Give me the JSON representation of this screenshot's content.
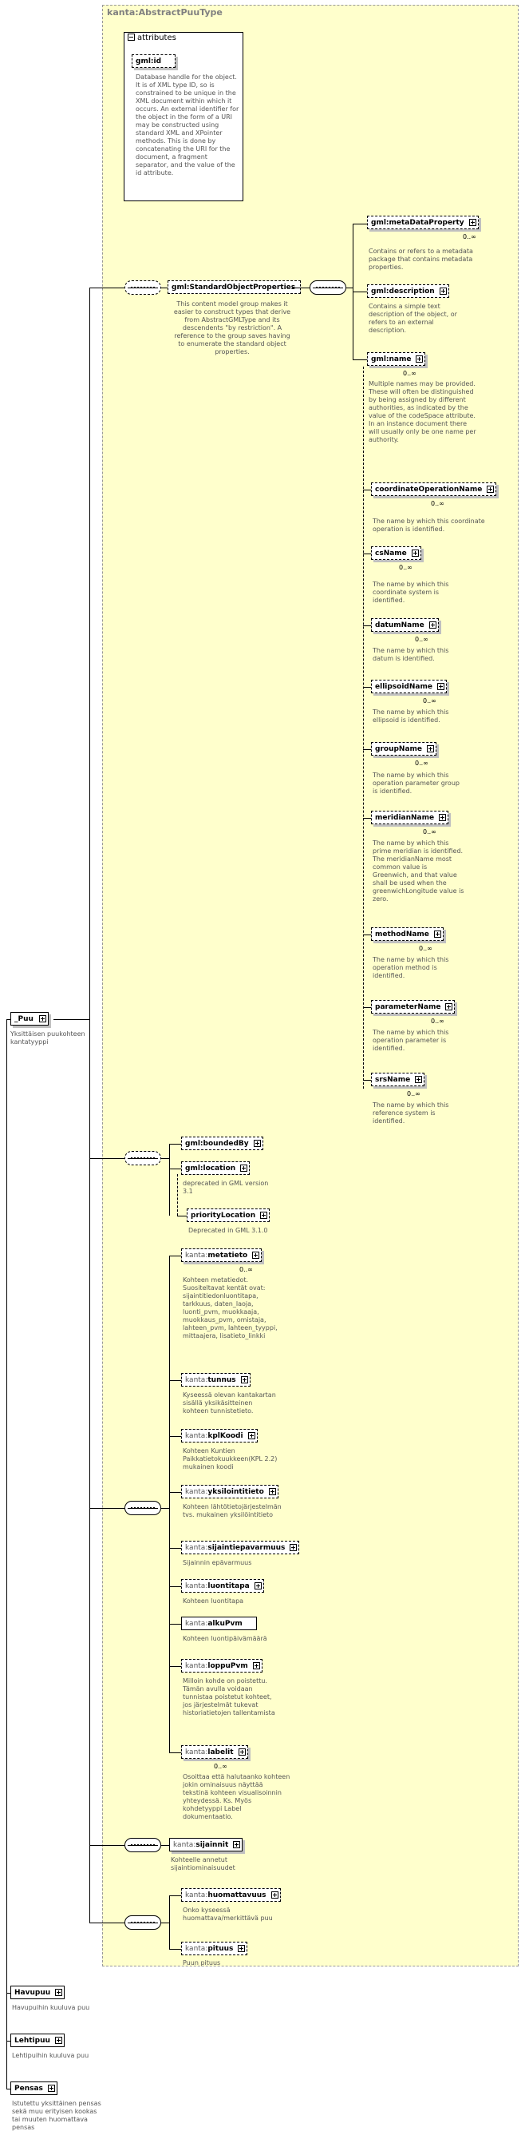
{
  "type_title": "kanta:AbstractPuuType",
  "attributes": {
    "header": "attributes",
    "gmlid": {
      "label": "gml:id",
      "desc": "Database handle for the object.  It is of XML type ID, so is constrained to be unique in the XML document within which it occurs.  An external identifier for the object in the form of a URI may be constructed using standard XML and XPointer methods.  This is done by concatenating the URI for the document, a fragment separator, and the value of the id attribute."
    }
  },
  "root": {
    "label": "_Puu",
    "desc": "Yksittäisen puukohteen kantatyyppi"
  },
  "standard_object_properties": {
    "label": "gml:StandardObjectProperties",
    "desc": "This content model group makes it easier to construct types that derive from AbstractGMLType and its descendents \"by restriction\".  A reference to the group saves having to enumerate the standard object properties."
  },
  "gml_elements": [
    {
      "label": "gml:metaDataProperty",
      "desc": "Contains or refers to a metadata package that contains metadata properties.",
      "mult": "0..∞"
    },
    {
      "label": "gml:description",
      "desc": "Contains a simple text description of the object, or refers to an external description.",
      "mult": ""
    },
    {
      "label": "gml:name",
      "desc": "Multiple names may be provided.  These will often be distinguished by being assigned by different authorities, as indicated by the value of the codeSpace attribute.  In an instance document there will usually only be one name per authority.",
      "mult": "0..∞"
    }
  ],
  "name_substitutions": [
    {
      "label": "coordinateOperationName",
      "desc": "The name by which this coordinate operation is identified.",
      "mult": "0..∞"
    },
    {
      "label": "csName",
      "desc": "The name by which this coordinate system is identified.",
      "mult": "0..∞"
    },
    {
      "label": "datumName",
      "desc": "The name by which this datum is identified.",
      "mult": "0..∞"
    },
    {
      "label": "ellipsoidName",
      "desc": "The name by which this ellipsoid is identified.",
      "mult": "0..∞"
    },
    {
      "label": "groupName",
      "desc": "The name by which this operation parameter group is identified.",
      "mult": "0..∞"
    },
    {
      "label": "meridianName",
      "desc": "The name by which this prime meridian is identified. The meridianName most common value is Greenwich, and that value shall be used when the greenwichLongitude value is zero.",
      "mult": "0..∞"
    },
    {
      "label": "methodName",
      "desc": "The name by which this operation method is identified.",
      "mult": "0..∞"
    },
    {
      "label": "parameterName",
      "desc": "The name by which this operation parameter is identified.",
      "mult": "0..∞"
    },
    {
      "label": "srsName",
      "desc": "The name by which this reference system is identified.",
      "mult": "0..∞"
    }
  ],
  "bounded_group": [
    {
      "label": "gml:boundedBy",
      "desc": ""
    },
    {
      "label": "gml:location",
      "desc": "deprecated in GML version 3.1"
    },
    {
      "label": "priorityLocation",
      "desc": "Deprecated in GML 3.1.0"
    }
  ],
  "kanta_elements": [
    {
      "prefix": "kanta:",
      "name": "metatieto",
      "desc": "Kohteen metatiedot. Suositeltavat kentät ovat: sijaintitiedonluontitapa, tarkkuus, daten_laoja, luonti_pvm, muokkaaja, muokkaus_pvm, omistaja, lahteen_pvm, lahteen_tyyppi, mittaajera, lisatieto_linkki",
      "mult": "0..∞"
    },
    {
      "prefix": "kanta:",
      "name": "tunnus",
      "desc": "Kyseessä olevan kantakartan sisällä yksikäsitteinen kohteen tunnistetieto.",
      "mult": ""
    },
    {
      "prefix": "kanta:",
      "name": "kplKoodi",
      "desc": "Kohteen Kuntien Paikkatietokuukkeen(KPL 2.2) mukainen koodi",
      "mult": ""
    },
    {
      "prefix": "kanta:",
      "name": "yksilointitieto",
      "desc": "Kohteen lähtötietojärjestelmän  tvs. mukainen yksilöintitieto",
      "mult": ""
    },
    {
      "prefix": "kanta:",
      "name": "sijaintiepavarmuus",
      "desc": "Sijainnin epävarmuus",
      "mult": ""
    },
    {
      "prefix": "kanta:",
      "name": "luontitapa",
      "desc": "Kohteen luontitapa",
      "mult": ""
    },
    {
      "prefix": "kanta:",
      "name": "alkuPvm",
      "desc": "Kohteen luontipäivämäärä",
      "mult": ""
    },
    {
      "prefix": "kanta:",
      "name": "loppuPvm",
      "desc": "Milloin kohde on poistettu. Tämän avulla voidaan tunnistaa poistetut kohteet, jos järjestelmät tukevat historiatietojen tallentamista",
      "mult": ""
    },
    {
      "prefix": "kanta:",
      "name": "labelit",
      "desc": "Osoittaa että halutaanko kohteen jokin ominaisuus näyttää tekstinä kohteen visualisoinnin yhteydessä.  Ks. Myös kohdetyyppi Label dokumentaatio.",
      "mult": "0..∞"
    }
  ],
  "sijainnit": {
    "prefix": "kanta:",
    "name": "sijainnit",
    "desc": "Kohteelle annetut sijaintiominaisuudet"
  },
  "last_group": [
    {
      "prefix": "kanta:",
      "name": "huomattavuus",
      "desc": "Onko kyseessä huomattava/merkittävä puu"
    },
    {
      "prefix": "kanta:",
      "name": "pituus",
      "desc": "Puun pituus"
    }
  ],
  "substitutions": [
    {
      "label": "Havupuu",
      "desc": "Havupuihin kuuluva puu"
    },
    {
      "label": "Lehtipuu",
      "desc": "Lehtipuihin kuuluva puu"
    },
    {
      "label": "Pensas",
      "desc": "Istutettu yksittäinen pensas sekä muu erityisen kookas tai muuten huomattava pensas"
    }
  ]
}
